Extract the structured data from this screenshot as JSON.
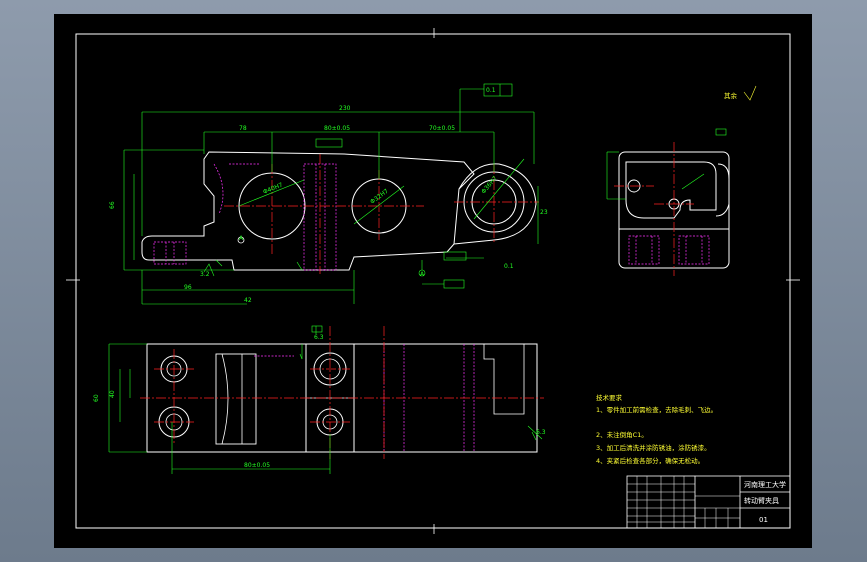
{
  "title_block": {
    "title_top": "河南理工大学",
    "title_bottom": "转动臂夹具",
    "part_id": "01"
  },
  "technical_notes": {
    "heading": "技术要求",
    "lines": [
      "1、零件加工前需检查，去除毛刺、飞边。",
      "2、未注倒角C1。",
      "3、加工后清洗并涂防锈油，涂防锈漆。",
      "4、夹紧后检查各部分，确保无松动。"
    ]
  },
  "roughness_note": "其余",
  "colors": {
    "background": "#000000",
    "frame": "#ffffff",
    "outline": "#ffffff",
    "hidden": "#ff33ff",
    "centerline": "#ff2222",
    "dimension": "#22ff22",
    "notes": "#ffff33"
  }
}
